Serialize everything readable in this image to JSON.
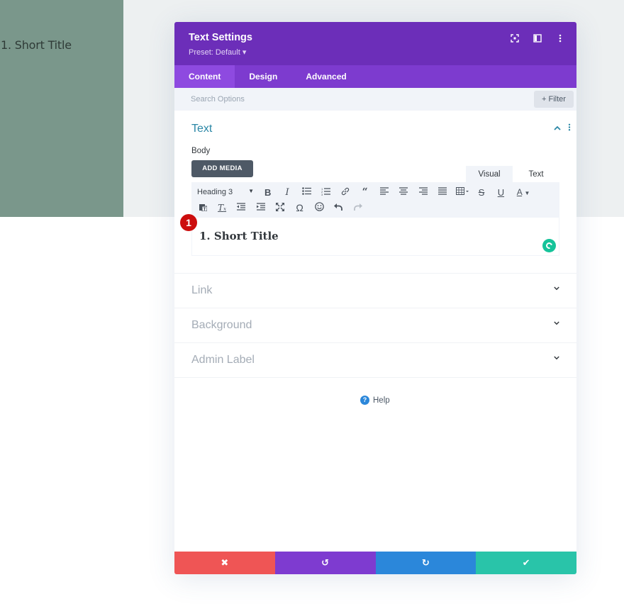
{
  "page": {
    "preview_title": "1. Short Title"
  },
  "modal": {
    "title": "Text Settings",
    "preset": "Preset: Default ▾",
    "header_icons": [
      "fullscreen-icon",
      "split-view-icon",
      "more-options-icon"
    ],
    "tabs": [
      {
        "label": "Content",
        "active": true
      },
      {
        "label": "Design",
        "active": false
      },
      {
        "label": "Advanced",
        "active": false
      }
    ],
    "search": {
      "placeholder": "Search Options",
      "filter_label": "+ Filter"
    },
    "text_section": {
      "title": "Text",
      "body_label": "Body",
      "add_media_label": "ADD MEDIA",
      "editor_tabs": [
        "Visual",
        "Text"
      ],
      "heading_select": "Heading 3",
      "toolbar_row1": [
        "bold",
        "italic",
        "bullet-list",
        "numbered-list",
        "link",
        "blockquote",
        "align-left",
        "align-center",
        "align-right",
        "align-justify",
        "table",
        "strikethrough",
        "underline",
        "text-color"
      ],
      "toolbar_row2": [
        "paste-as-text",
        "clear-formatting",
        "outdent",
        "indent",
        "fullscreen",
        "special-character",
        "emoji",
        "undo",
        "redo"
      ],
      "editor_content": "1. Short Title",
      "step_badge": "1"
    },
    "sections": [
      {
        "label": "Link"
      },
      {
        "label": "Background"
      },
      {
        "label": "Admin Label"
      }
    ],
    "help_label": "Help",
    "footer": {
      "cancel": "✖",
      "undo": "↺",
      "redo": "↻",
      "save": "✔"
    }
  },
  "colors": {
    "header": "#6c2eb9",
    "tabs": "#7d3bcf",
    "active_tab": "#8e4ae0",
    "section_title": "#2b87a6",
    "cancel": "#ef5555",
    "undo": "#7e3bd0",
    "redo": "#2b87da",
    "save": "#29c4a9",
    "preview_bg": "#7a978b"
  }
}
